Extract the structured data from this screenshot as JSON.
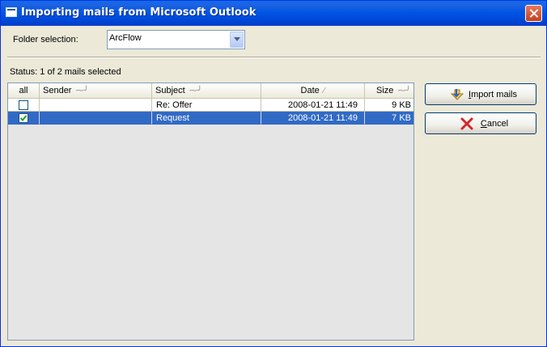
{
  "window": {
    "title": "Importing mails from Microsoft Outlook"
  },
  "folder": {
    "label": "Folder selection:",
    "selected": "ArcFlow"
  },
  "status": {
    "text": "Status: 1 of 2 mails selected"
  },
  "table": {
    "columns": {
      "all": "all",
      "sender": "Sender",
      "subject": "Subject",
      "date": "Date",
      "size": "Size"
    },
    "rows": [
      {
        "checked": false,
        "sender": "",
        "subject": "Re: Offer",
        "date": "2008-01-21 11:49",
        "size": "9 KB"
      },
      {
        "checked": true,
        "sender": "",
        "subject": "Request",
        "date": "2008-01-21 11:49",
        "size": "7 KB"
      }
    ]
  },
  "buttons": {
    "import": {
      "accel": "I",
      "rest": "mport mails"
    },
    "cancel": {
      "accel": "C",
      "rest": "ancel"
    }
  },
  "icons": {
    "window": "window-icon",
    "close": "close-icon",
    "import": "import-icon",
    "cancel": "cancel-x-icon",
    "dropdown": "chevron-down-icon"
  },
  "colors": {
    "titlebar": "#0054e3",
    "selection": "#316ac5",
    "cancel_x": "#d3262a"
  }
}
